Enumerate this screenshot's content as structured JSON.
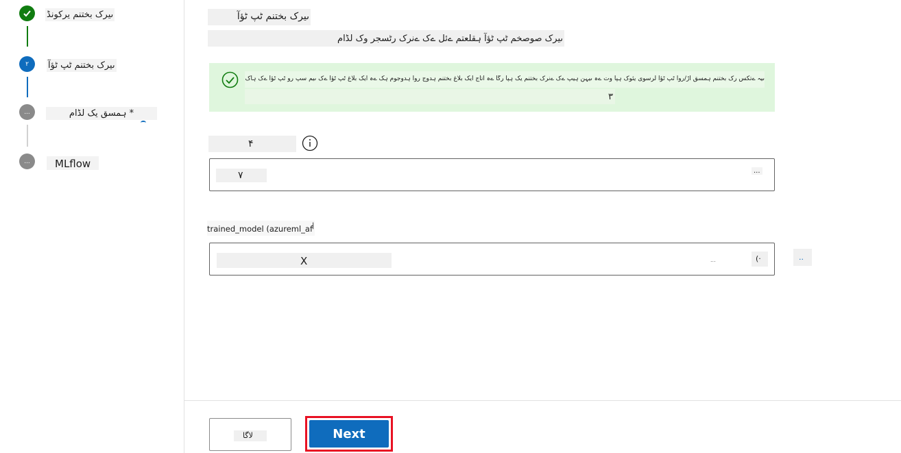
{
  "stepper": {
    "steps": [
      {
        "label": "ںیرک بختنم یرکونڈ",
        "number": "",
        "state": "done"
      },
      {
        "label": "ںیرک بختنم ٹپ ٹؤآ",
        "number": "۲",
        "state": "current"
      },
      {
        "label": "* ہمسق یک لڈام",
        "number": "...",
        "state": "pending"
      },
      {
        "label": "MLflow",
        "number": "...",
        "state": "pending"
      }
    ]
  },
  "main": {
    "section_title": "ںیرک بختنم ٹپ ٹؤآ",
    "section_desc": "ںیرک صوصخم ٹپ ٹؤآ ہقلعتم ےئل ےک ےنرک رٹسجر وک لڈام",
    "banner": {
      "text": "ںیہ ےتکس رک بختنم ہمسق اڑ/روا ٹپ ٹؤآ لرسوی یئوک ہپآ وت ےہ ںیہن ہیپ ےک ےنرک بختنم یک ہپآ رگا ےہ اتاج ایک بلاغ بختنم ہدوج روا ہدوجوم ہک ےہ ایک بلاغ ٹپ ٹؤآ ےک ںیم سپ رو ٹپ ٹؤآ ےک ہاک",
      "number": "۳"
    },
    "job_output": {
      "label": "۴",
      "value": "۷",
      "more": "..."
    },
    "model_output": {
      "label": "trained_model (azureml_af",
      "value": "X",
      "hint": "...",
      "extra": "(·",
      "side": ".."
    }
  },
  "footer": {
    "back_label": "لاگا",
    "next_label": "Next"
  },
  "colors": {
    "accent": "#0f6cbd",
    "success": "#107c10",
    "banner_bg": "#dff6dd",
    "highlight": "#e81123"
  }
}
